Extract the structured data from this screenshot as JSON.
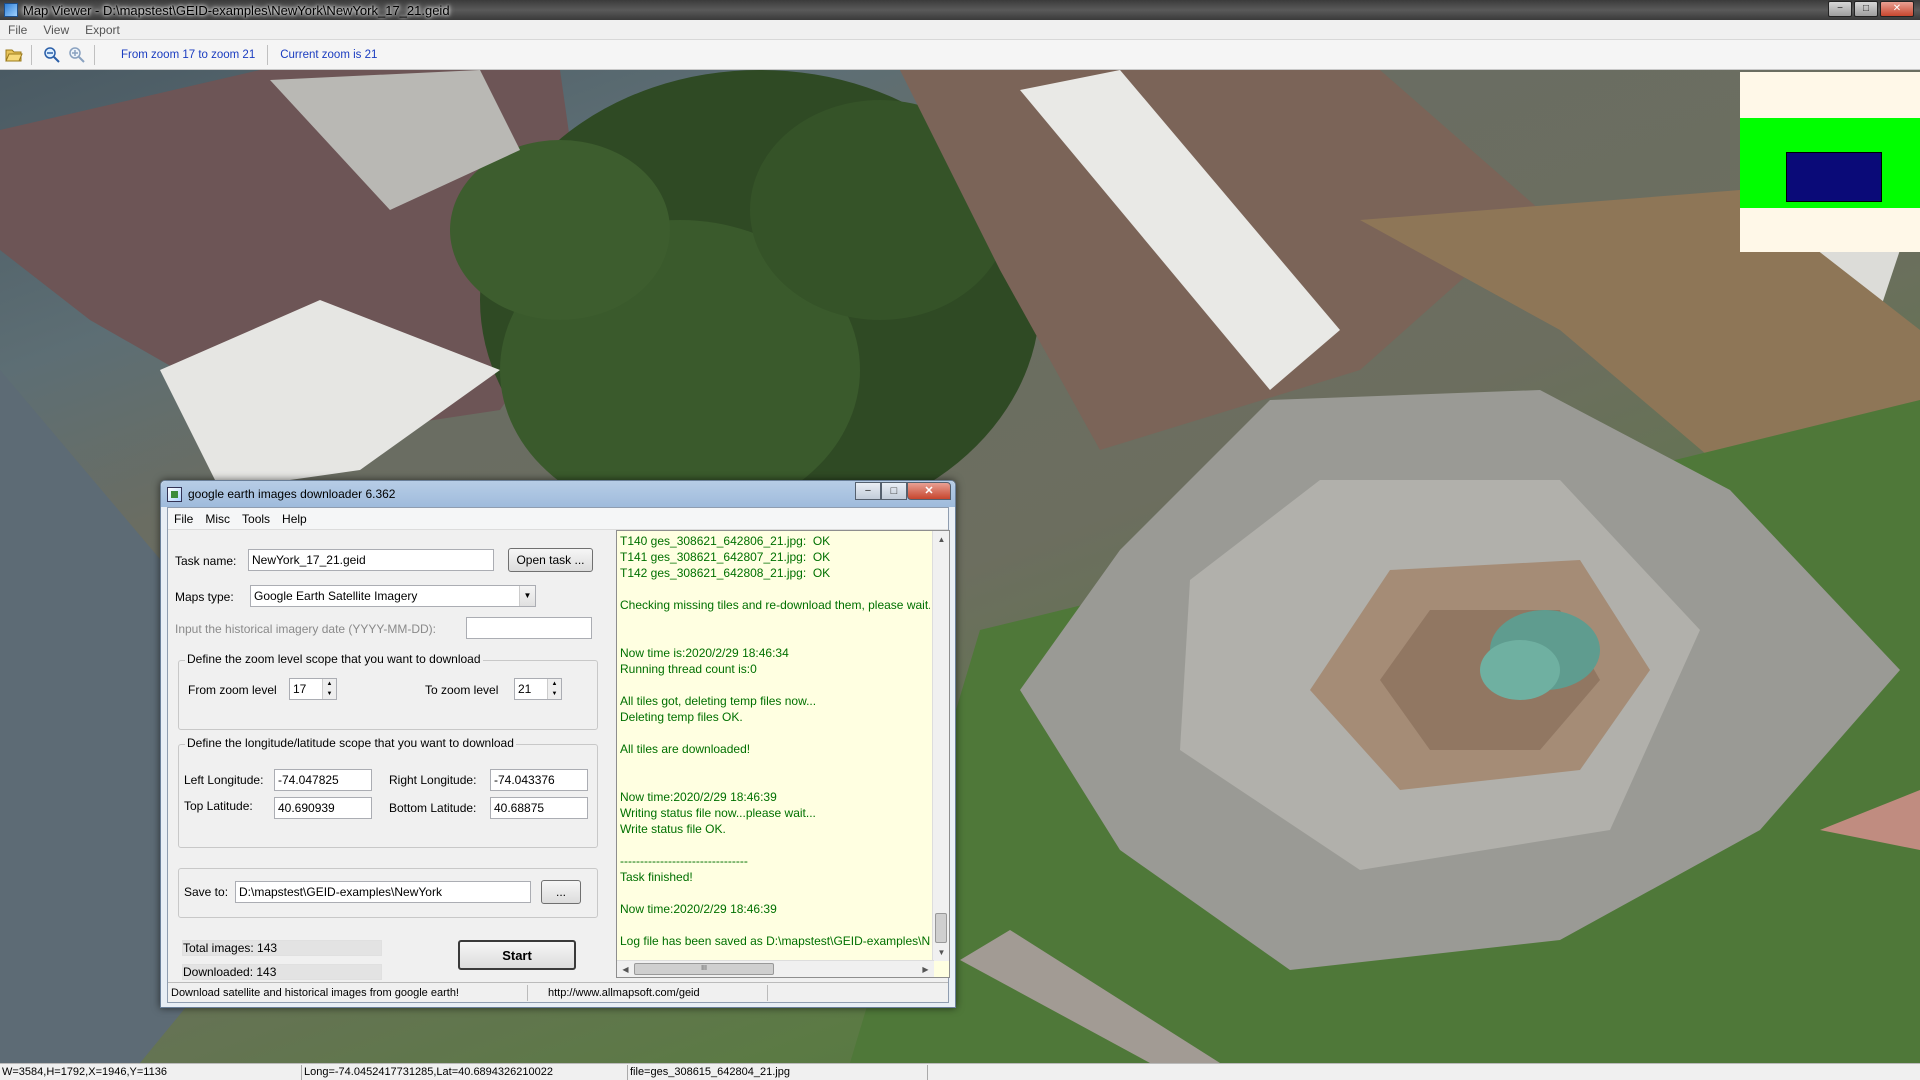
{
  "window": {
    "title": "Map Viewer - D:\\mapstest\\GEID-examples\\NewYork\\NewYork_17_21.geid",
    "controls": {
      "minimize": "−",
      "maximize": "□",
      "close": "✕"
    }
  },
  "menu": {
    "file": "File",
    "view": "View",
    "export": "Export"
  },
  "toolbar": {
    "open_icon": "folder-open-icon",
    "zoom_out_icon": "zoom-out-icon",
    "zoom_in_icon": "zoom-in-icon",
    "zoom_range_text": "From zoom 17 to zoom 21",
    "current_zoom_text": "Current zoom is 21"
  },
  "map": {
    "overlay_colors": {
      "background": "#fff8e8",
      "band": "#00ff00",
      "box": "#0a0a78"
    }
  },
  "statusbar": {
    "dims": "W=3584,H=1792,X=1946,Y=1136",
    "coords": "Long=-74.0452417731285,Lat=40.6894326210022",
    "file": "file=ges_308615_642804_21.jpg"
  },
  "dialog": {
    "title": "google earth images downloader 6.362",
    "menu": {
      "file": "File",
      "misc": "Misc",
      "tools": "Tools",
      "help": "Help"
    },
    "task_name_label": "Task name:",
    "task_name_value": "NewYork_17_21.geid",
    "open_task_button": "Open task ...",
    "maps_type_label": "Maps type:",
    "maps_type_value": "Google Earth Satellite Imagery",
    "history_date_label": "Input the  historical imagery date (YYYY-MM-DD):",
    "history_date_value": "",
    "zoom_group_title": "Define the zoom level scope that you want to download",
    "from_zoom_label": "From zoom level",
    "from_zoom_value": "17",
    "to_zoom_label": "To zoom level",
    "to_zoom_value": "21",
    "lonlat_group_title": "Define the longitude/latitude scope that you want to download",
    "left_lon_label": "Left Longitude:",
    "left_lon_value": "-74.047825",
    "right_lon_label": "Right Longitude:",
    "right_lon_value": "-74.043376",
    "top_lat_label": "Top Latitude:",
    "top_lat_value": "40.690939",
    "bottom_lat_label": "Bottom Latitude:",
    "bottom_lat_value": "40.68875",
    "save_to_label": "Save to:",
    "save_to_value": "D:\\mapstest\\GEID-examples\\NewYork",
    "browse_button": "...",
    "total_images_label": "Total images: 143",
    "downloaded_label": "Downloaded: 143",
    "start_button": "Start",
    "log_lines": [
      "T140 ges_308621_642806_21.jpg:  OK",
      "T141 ges_308621_642807_21.jpg:  OK",
      "T142 ges_308621_642808_21.jpg:  OK",
      "",
      "Checking missing tiles and re-download them, please wait...",
      "",
      "",
      "Now time is:2020/2/29 18:46:34",
      "Running thread count is:0",
      "",
      "All tiles got, deleting temp files now...",
      "Deleting temp files OK.",
      "",
      "All tiles are downloaded!",
      "",
      "",
      "Now time:2020/2/29 18:46:39",
      "Writing status file now...please wait...",
      "Write status file OK.",
      "",
      "--------------------------------",
      "Task finished!",
      "",
      "Now time:2020/2/29 18:46:39",
      "",
      "Log file has been saved as D:\\mapstest\\GEID-examples\\NewYork"
    ],
    "hscroll_thumb": "III",
    "status_left": "Download satellite and historical  images from google earth!",
    "status_right": "http://www.allmapsoft.com/geid"
  }
}
